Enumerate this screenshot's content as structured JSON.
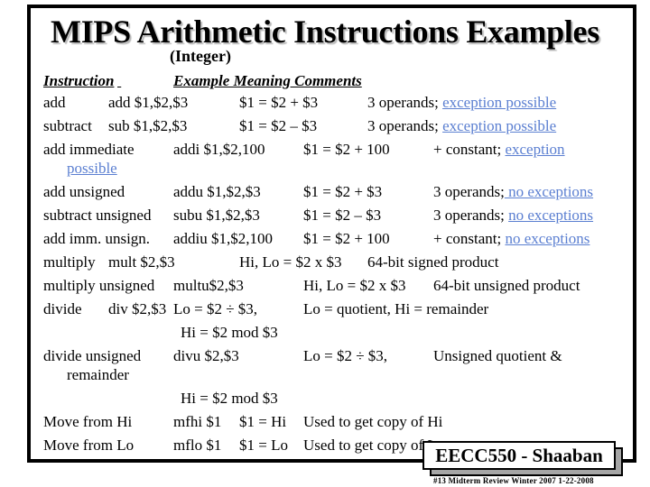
{
  "slide": {
    "title": "MIPS Arithmetic Instructions Examples",
    "subtitle": "(Integer)",
    "header": {
      "instruction": "Instruction",
      "rest": "Example Meaning Comments"
    },
    "rows": [
      {
        "instr": "add",
        "example": "add $1,$2,$3",
        "meaning": "$1 = $2 + $3",
        "comment_plain": "3 operands; ",
        "comment_link": "exception possible"
      },
      {
        "instr": "subtract",
        "example": "sub $1,$2,$3",
        "meaning": "$1 = $2 – $3",
        "comment_plain": "3 operands; ",
        "comment_link": "exception possible"
      },
      {
        "instr": "add immediate",
        "example": "addi $1,$2,100",
        "meaning": "$1 = $2 + 100",
        "comment_plain": "+ constant; ",
        "comment_link": "exception",
        "wrap_link": "possible"
      },
      {
        "instr": "add unsigned",
        "example": "addu $1,$2,$3",
        "meaning": "$1 = $2 + $3",
        "comment_plain": "3 operands;",
        "comment_link": " no exceptions"
      },
      {
        "instr": "subtract unsigned",
        "example": "subu $1,$2,$3",
        "meaning": "$1 = $2 – $3",
        "comment_plain": "3 operands; ",
        "comment_link": "no exceptions"
      },
      {
        "instr": "add imm. unsign.",
        "example": "addiu $1,$2,100",
        "meaning": "$1 = $2 + 100",
        "comment_plain": "+ constant; ",
        "comment_link": "no exceptions"
      },
      {
        "instr": "multiply",
        "example": "mult $2,$3",
        "meaning": "Hi, Lo = $2 x $3",
        "comment_plain": "64-bit signed product"
      },
      {
        "instr": "multiply unsigned",
        "example": "multu$2,$3",
        "meaning": "Hi, Lo = $2 x $3",
        "comment_plain": "64-bit unsigned product"
      },
      {
        "instr": "divide",
        "example": "div $2,$3",
        "meaning": "Lo = $2 ÷ $3,",
        "meaning2": "Hi = $2 mod $3",
        "comment_plain": "Lo = quotient, Hi = remainder"
      },
      {
        "instr": "divide unsigned",
        "instr_wrap": "remainder",
        "example": "divu $2,$3",
        "meaning": "Lo = $2 ÷ $3,",
        "meaning2": "Hi = $2 mod $3",
        "comment_plain": "Unsigned quotient &"
      },
      {
        "instr": "Move from Hi",
        "example": "mfhi $1",
        "meaning": "$1 = Hi",
        "comment_plain": "Used to get copy of Hi"
      },
      {
        "instr": "Move from Lo",
        "example": "mflo $1",
        "meaning": "$1 = Lo",
        "comment_plain": "Used to get copy of Lo"
      }
    ]
  },
  "badge": "EECC550 - Shaaban",
  "footer": "#13   Midterm Review   Winter 2007  1-22-2008",
  "colors": {
    "link": "#5b7fd1",
    "badge_shadow": "#a6a6a6"
  }
}
